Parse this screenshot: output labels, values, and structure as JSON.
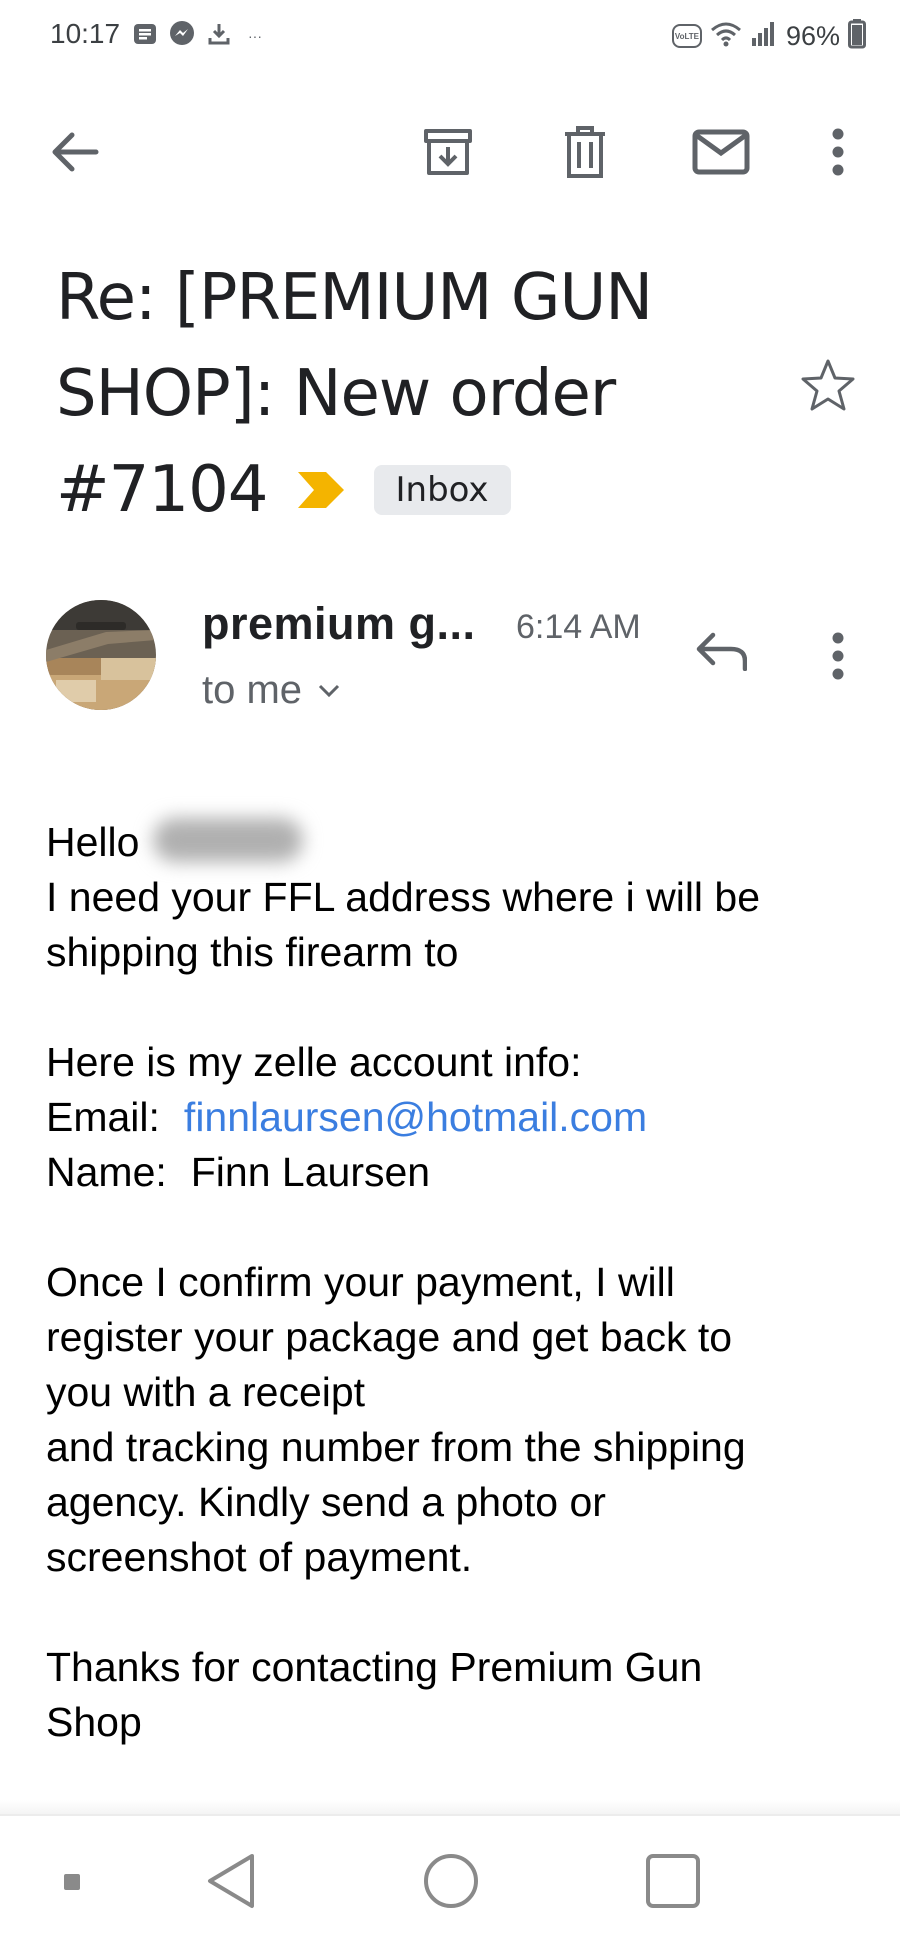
{
  "status_bar": {
    "time": "10:17",
    "battery": "96%",
    "volte_label": "VoLTE",
    "more_notifications": "···"
  },
  "toolbar": {
    "back_icon": "arrow-back-icon",
    "archive_icon": "archive-icon",
    "delete_icon": "trash-icon",
    "mark_unread_icon": "mail-icon",
    "more_icon": "more-vert-icon"
  },
  "email": {
    "subject_line1": "Re: [PREMIUM GUN",
    "subject_line2": "SHOP]: New order",
    "subject_line3": "#7104",
    "label": "Inbox",
    "important_color": "#f4b400",
    "sender": "premium g...",
    "time": "6:14 AM",
    "recipient": "to me",
    "body": {
      "greeting": "Hello",
      "line1": "I need your FFL address where i will be\nshipping this firearm to",
      "line2": "Here is my zelle account info:",
      "email_label": "Email:",
      "email_value": "finnlaursen@hotmail.com",
      "name_label": "Name:",
      "name_value": "Finn Laursen",
      "paragraph2": "Once I confirm your payment, I will\nregister your package and get back to\nyou with a receipt\nand tracking number from the shipping\nagency. Kindly send a photo or\nscreenshot of payment.",
      "paragraph3": "Thanks for contacting Premium Gun\nShop"
    }
  },
  "colors": {
    "link": "#3b7ee0",
    "icon": "#5f6368",
    "chip_bg": "#e8eaed"
  },
  "nav_bar": {
    "recents_small_icon": "square-small-icon",
    "back_icon": "triangle-back-icon",
    "home_icon": "circle-home-icon",
    "overview_icon": "square-overview-icon"
  }
}
